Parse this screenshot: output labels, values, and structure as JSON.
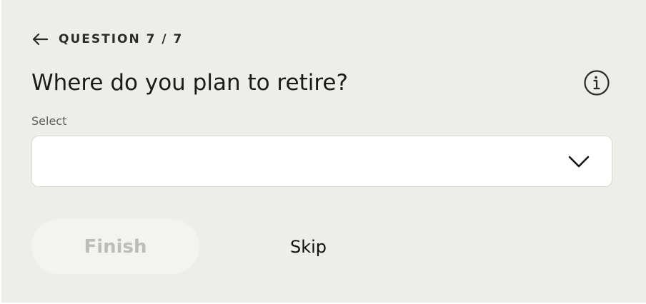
{
  "header": {
    "back_icon": "arrow-left-icon",
    "progress": "QUESTION 7 / 7"
  },
  "question": {
    "title": "Where do you plan to retire?",
    "info_icon": "info-circle-icon"
  },
  "select": {
    "label": "Select",
    "value": "",
    "chevron_icon": "chevron-down-icon"
  },
  "actions": {
    "finish_label": "Finish",
    "finish_disabled": true,
    "skip_label": "Skip"
  },
  "colors": {
    "panel_background": "#ededea",
    "text_primary": "#1a1a18",
    "finish_disabled_background": "#f3f3f1",
    "finish_disabled_text": "#bdbdb8"
  }
}
